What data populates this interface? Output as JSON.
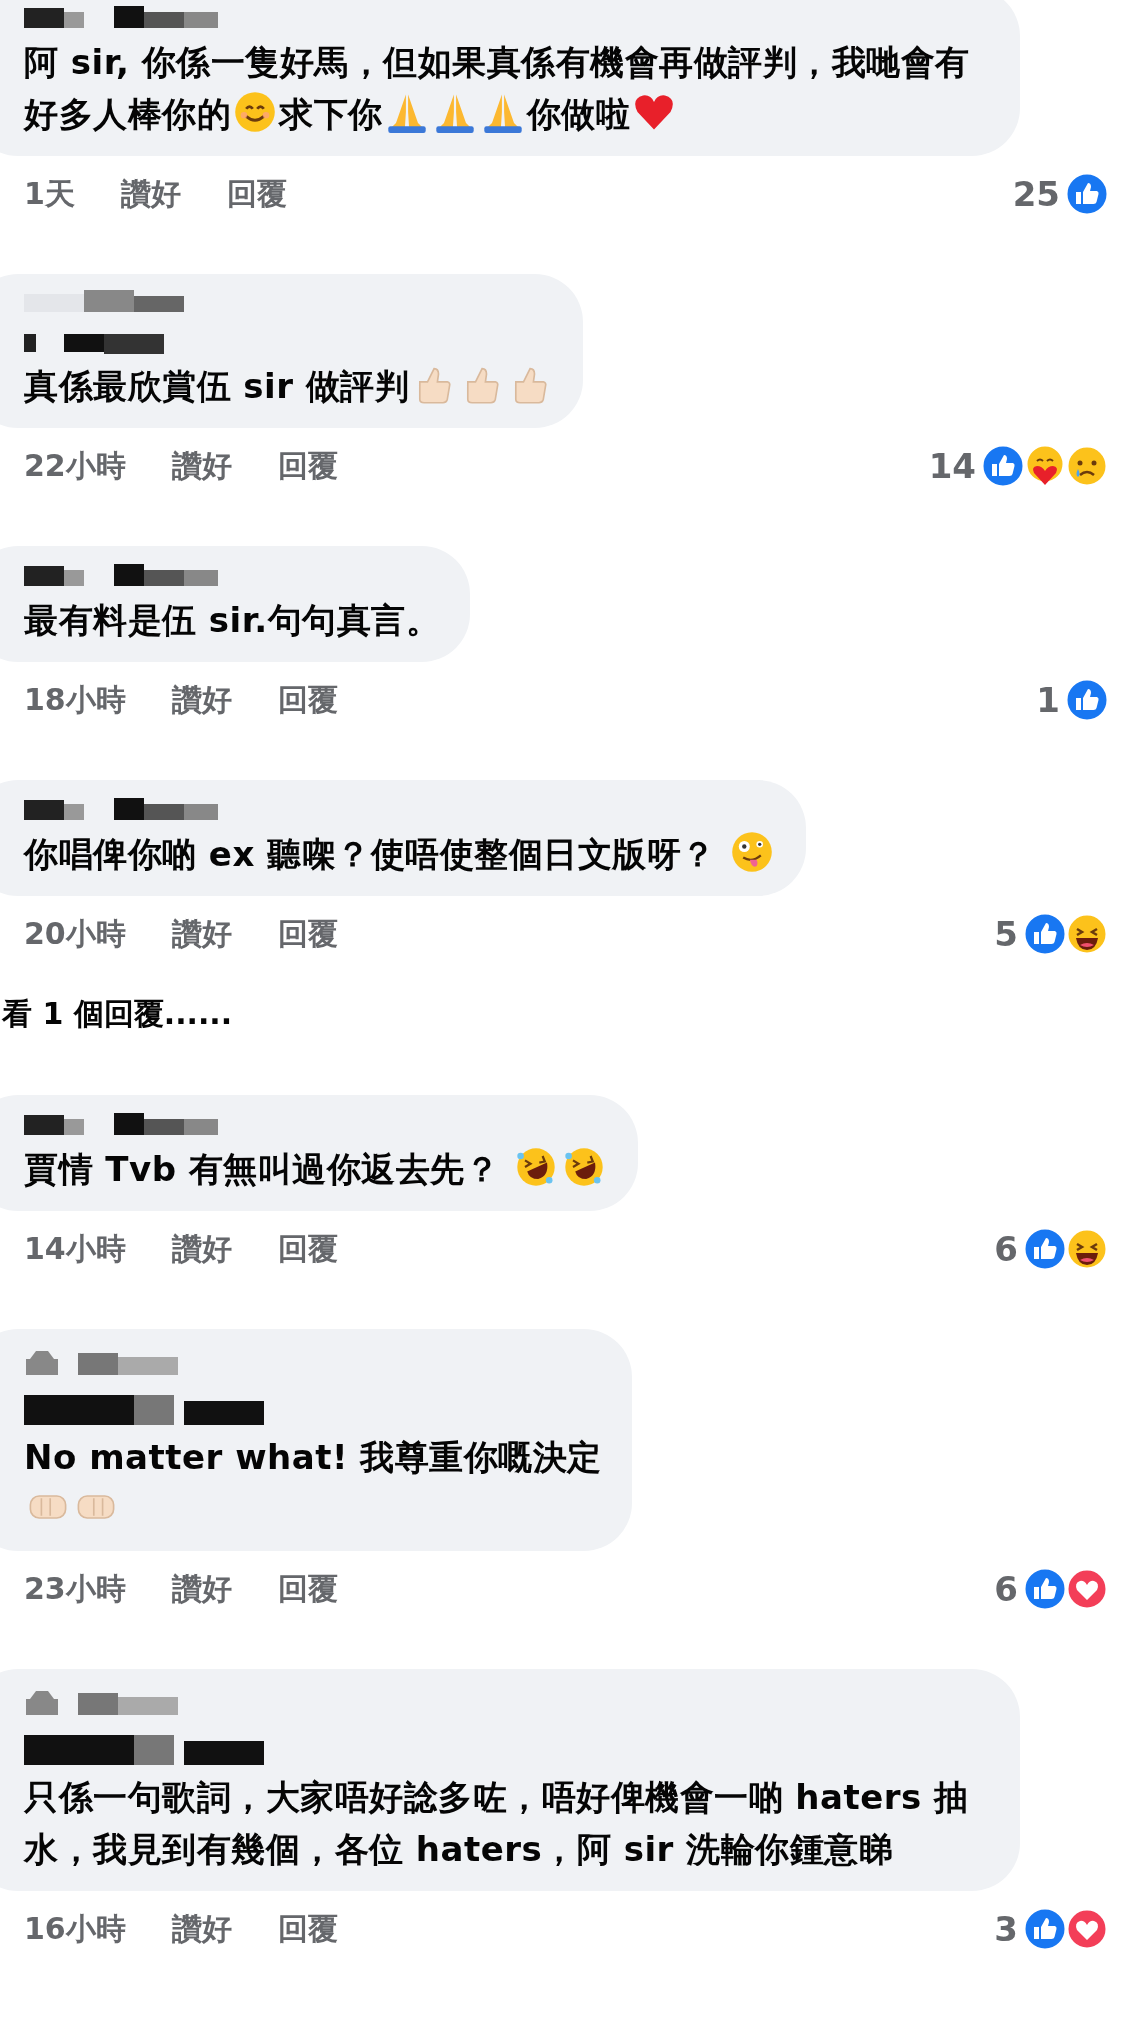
{
  "comments": [
    {
      "author": {
        "kind": "pixelated"
      },
      "body": [
        {
          "kind": "text",
          "text": "阿 sir, 你係一隻好馬，但如果真係有機會再做評判，我哋會有好多人棒你的"
        },
        {
          "kind": "smile"
        },
        {
          "kind": "text",
          "text": "求下你"
        },
        {
          "kind": "pray"
        },
        {
          "kind": "pray"
        },
        {
          "kind": "pray"
        },
        {
          "kind": "text",
          "text": "你做啦"
        },
        {
          "kind": "heart"
        }
      ],
      "time": "1天",
      "like_label": "讚好",
      "reply_label": "回覆",
      "reaction_count": "25",
      "reactions": [
        {
          "kind": "like"
        }
      ]
    },
    {
      "author": {
        "kind": "pixelated_two_line"
      },
      "body": [
        {
          "kind": "text",
          "text": "真係最欣賞伍 sir 做評判"
        },
        {
          "kind": "thumbs"
        },
        {
          "kind": "thumbs"
        },
        {
          "kind": "thumbs"
        }
      ],
      "time": "22小時",
      "like_label": "讚好",
      "reply_label": "回覆",
      "reaction_count": "14",
      "reactions": [
        {
          "kind": "like"
        },
        {
          "kind": "care"
        },
        {
          "kind": "sad"
        }
      ]
    },
    {
      "author": {
        "kind": "pixelated"
      },
      "body": [
        {
          "kind": "text",
          "text": "最有料是伍 sir.句句真言。"
        }
      ],
      "time": "18小時",
      "like_label": "讚好",
      "reply_label": "回覆",
      "reaction_count": "1",
      "reactions": [
        {
          "kind": "like"
        }
      ]
    },
    {
      "author": {
        "kind": "pixelated"
      },
      "body": [
        {
          "kind": "text",
          "text": "你唱俾你啲 ex 聽㗎？使唔使整個日文版呀？ "
        },
        {
          "kind": "zany"
        }
      ],
      "time": "20小時",
      "like_label": "讚好",
      "reply_label": "回覆",
      "reaction_count": "5",
      "reactions": [
        {
          "kind": "like"
        },
        {
          "kind": "haha"
        }
      ],
      "more_replies": "看 1 個回覆......"
    },
    {
      "author": {
        "kind": "pixelated"
      },
      "body": [
        {
          "kind": "text",
          "text": "賈情 Tvb 有無叫過你返去先？ "
        },
        {
          "kind": "rofl"
        },
        {
          "kind": "rofl"
        }
      ],
      "time": "14小時",
      "like_label": "讚好",
      "reply_label": "回覆",
      "reaction_count": "6",
      "reactions": [
        {
          "kind": "like"
        },
        {
          "kind": "haha"
        }
      ]
    },
    {
      "author": {
        "kind": "pixelated_with_badge"
      },
      "body": [
        {
          "kind": "text",
          "text": "No matter what! 我尊重你嘅決定"
        },
        {
          "kind": "break"
        },
        {
          "kind": "fist_right"
        },
        {
          "kind": "fist_left"
        }
      ],
      "time": "23小時",
      "like_label": "讚好",
      "reply_label": "回覆",
      "reaction_count": "6",
      "reactions": [
        {
          "kind": "like"
        },
        {
          "kind": "love"
        }
      ]
    },
    {
      "author": {
        "kind": "pixelated_with_badge"
      },
      "body": [
        {
          "kind": "text",
          "text": "只係一句歌詞，大家唔好諗多咗，唔好俾機會一啲 haters 抽水，我見到有幾個，各位 haters，阿 sir 洗輪你鍾意睇"
        }
      ],
      "time": "16小時",
      "like_label": "讚好",
      "reply_label": "回覆",
      "reaction_count": "3",
      "reactions": [
        {
          "kind": "like"
        },
        {
          "kind": "love"
        }
      ]
    }
  ]
}
